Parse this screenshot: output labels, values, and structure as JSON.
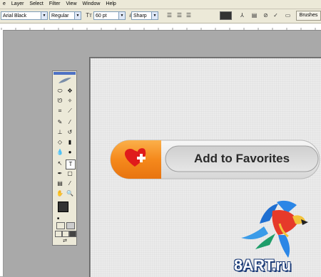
{
  "menubar": {
    "items": [
      "e",
      "Layer",
      "Select",
      "Filter",
      "View",
      "Window",
      "Help"
    ]
  },
  "options": {
    "font_family": "Arial Black",
    "font_style": "Regular",
    "font_size": "60 pt",
    "antialias": "Sharp",
    "text_color": "#333333",
    "brushes_label": "Brushes"
  },
  "canvas": {
    "button_text": "Add to Favorites",
    "accent_color": "#f5891c",
    "heart_color": "#e01b1b"
  },
  "watermark": {
    "text": "8ART.ru"
  }
}
